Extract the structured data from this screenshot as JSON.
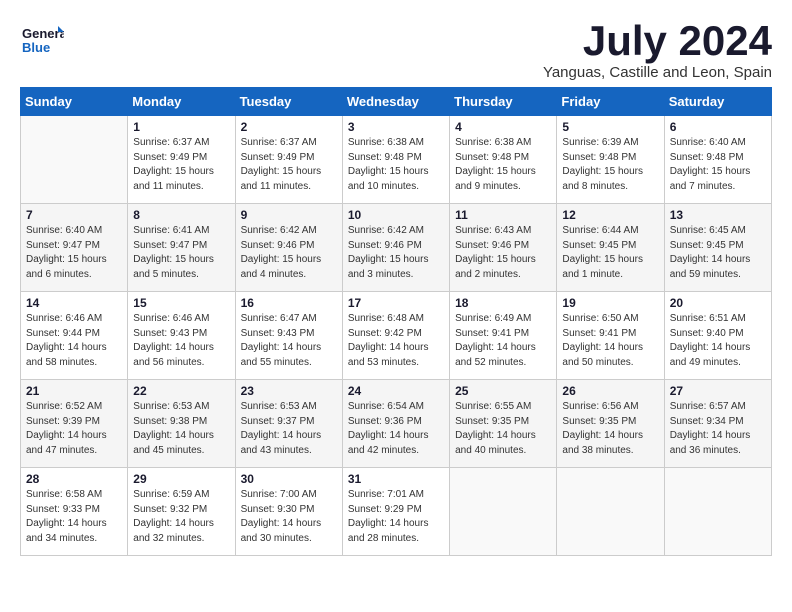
{
  "logo": {
    "line1": "General",
    "line2": "Blue"
  },
  "title": "July 2024",
  "location": "Yanguas, Castille and Leon, Spain",
  "weekdays": [
    "Sunday",
    "Monday",
    "Tuesday",
    "Wednesday",
    "Thursday",
    "Friday",
    "Saturday"
  ],
  "weeks": [
    [
      {
        "day": "",
        "empty": true
      },
      {
        "day": "1",
        "sunrise": "6:37 AM",
        "sunset": "9:49 PM",
        "daylight": "15 hours and 11 minutes."
      },
      {
        "day": "2",
        "sunrise": "6:37 AM",
        "sunset": "9:49 PM",
        "daylight": "15 hours and 11 minutes."
      },
      {
        "day": "3",
        "sunrise": "6:38 AM",
        "sunset": "9:48 PM",
        "daylight": "15 hours and 10 minutes."
      },
      {
        "day": "4",
        "sunrise": "6:38 AM",
        "sunset": "9:48 PM",
        "daylight": "15 hours and 9 minutes."
      },
      {
        "day": "5",
        "sunrise": "6:39 AM",
        "sunset": "9:48 PM",
        "daylight": "15 hours and 8 minutes."
      },
      {
        "day": "6",
        "sunrise": "6:40 AM",
        "sunset": "9:48 PM",
        "daylight": "15 hours and 7 minutes."
      }
    ],
    [
      {
        "day": "7",
        "sunrise": "6:40 AM",
        "sunset": "9:47 PM",
        "daylight": "15 hours and 6 minutes."
      },
      {
        "day": "8",
        "sunrise": "6:41 AM",
        "sunset": "9:47 PM",
        "daylight": "15 hours and 5 minutes."
      },
      {
        "day": "9",
        "sunrise": "6:42 AM",
        "sunset": "9:46 PM",
        "daylight": "15 hours and 4 minutes."
      },
      {
        "day": "10",
        "sunrise": "6:42 AM",
        "sunset": "9:46 PM",
        "daylight": "15 hours and 3 minutes."
      },
      {
        "day": "11",
        "sunrise": "6:43 AM",
        "sunset": "9:46 PM",
        "daylight": "15 hours and 2 minutes."
      },
      {
        "day": "12",
        "sunrise": "6:44 AM",
        "sunset": "9:45 PM",
        "daylight": "15 hours and 1 minute."
      },
      {
        "day": "13",
        "sunrise": "6:45 AM",
        "sunset": "9:45 PM",
        "daylight": "14 hours and 59 minutes."
      }
    ],
    [
      {
        "day": "14",
        "sunrise": "6:46 AM",
        "sunset": "9:44 PM",
        "daylight": "14 hours and 58 minutes."
      },
      {
        "day": "15",
        "sunrise": "6:46 AM",
        "sunset": "9:43 PM",
        "daylight": "14 hours and 56 minutes."
      },
      {
        "day": "16",
        "sunrise": "6:47 AM",
        "sunset": "9:43 PM",
        "daylight": "14 hours and 55 minutes."
      },
      {
        "day": "17",
        "sunrise": "6:48 AM",
        "sunset": "9:42 PM",
        "daylight": "14 hours and 53 minutes."
      },
      {
        "day": "18",
        "sunrise": "6:49 AM",
        "sunset": "9:41 PM",
        "daylight": "14 hours and 52 minutes."
      },
      {
        "day": "19",
        "sunrise": "6:50 AM",
        "sunset": "9:41 PM",
        "daylight": "14 hours and 50 minutes."
      },
      {
        "day": "20",
        "sunrise": "6:51 AM",
        "sunset": "9:40 PM",
        "daylight": "14 hours and 49 minutes."
      }
    ],
    [
      {
        "day": "21",
        "sunrise": "6:52 AM",
        "sunset": "9:39 PM",
        "daylight": "14 hours and 47 minutes."
      },
      {
        "day": "22",
        "sunrise": "6:53 AM",
        "sunset": "9:38 PM",
        "daylight": "14 hours and 45 minutes."
      },
      {
        "day": "23",
        "sunrise": "6:53 AM",
        "sunset": "9:37 PM",
        "daylight": "14 hours and 43 minutes."
      },
      {
        "day": "24",
        "sunrise": "6:54 AM",
        "sunset": "9:36 PM",
        "daylight": "14 hours and 42 minutes."
      },
      {
        "day": "25",
        "sunrise": "6:55 AM",
        "sunset": "9:35 PM",
        "daylight": "14 hours and 40 minutes."
      },
      {
        "day": "26",
        "sunrise": "6:56 AM",
        "sunset": "9:35 PM",
        "daylight": "14 hours and 38 minutes."
      },
      {
        "day": "27",
        "sunrise": "6:57 AM",
        "sunset": "9:34 PM",
        "daylight": "14 hours and 36 minutes."
      }
    ],
    [
      {
        "day": "28",
        "sunrise": "6:58 AM",
        "sunset": "9:33 PM",
        "daylight": "14 hours and 34 minutes."
      },
      {
        "day": "29",
        "sunrise": "6:59 AM",
        "sunset": "9:32 PM",
        "daylight": "14 hours and 32 minutes."
      },
      {
        "day": "30",
        "sunrise": "7:00 AM",
        "sunset": "9:30 PM",
        "daylight": "14 hours and 30 minutes."
      },
      {
        "day": "31",
        "sunrise": "7:01 AM",
        "sunset": "9:29 PM",
        "daylight": "14 hours and 28 minutes."
      },
      {
        "day": "",
        "empty": true
      },
      {
        "day": "",
        "empty": true
      },
      {
        "day": "",
        "empty": true
      }
    ]
  ]
}
